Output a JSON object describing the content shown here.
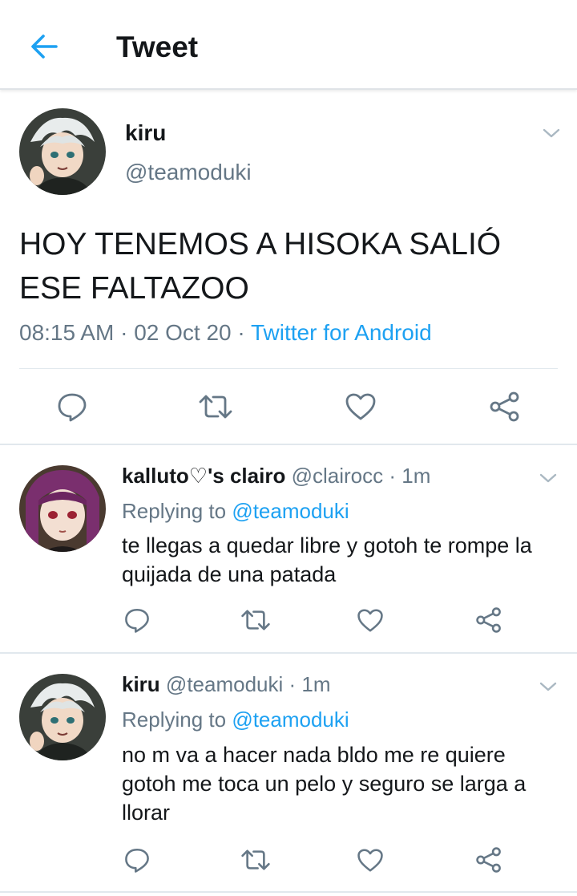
{
  "header": {
    "title": "Tweet"
  },
  "main_tweet": {
    "name": "kiru",
    "handle": "@teamoduki",
    "text": "HOY TENEMOS A HISOKA SALIÓ ESE FALTAZOO",
    "time": "08:15 AM",
    "sep1": "·",
    "date": "02 Oct 20",
    "sep2": "·",
    "source": "Twitter for Android"
  },
  "replies": [
    {
      "name": "kalluto♡'s clairo",
      "handle": "@clairocc",
      "sep": "·",
      "time": "1m",
      "replying_prefix": "Replying to",
      "replying_to": "@teamoduki",
      "text": "te llegas a quedar libre y gotoh te rompe la quijada de una patada"
    },
    {
      "name": "kiru",
      "handle": "@teamoduki",
      "sep": "·",
      "time": "1m",
      "replying_prefix": "Replying to",
      "replying_to": "@teamoduki",
      "text": "no m va a hacer nada bldo me re quiere gotoh me toca un pelo y seguro se larga a llorar"
    }
  ],
  "icons": {
    "back": "arrow-left-icon",
    "caret": "chevron-down-icon",
    "reply": "reply-icon",
    "retweet": "retweet-icon",
    "like": "heart-icon",
    "share": "share-icon"
  },
  "colors": {
    "accent": "#1da1f2",
    "secondary_text": "#657786",
    "icon": "#657786",
    "divider": "#e1e8ed"
  }
}
